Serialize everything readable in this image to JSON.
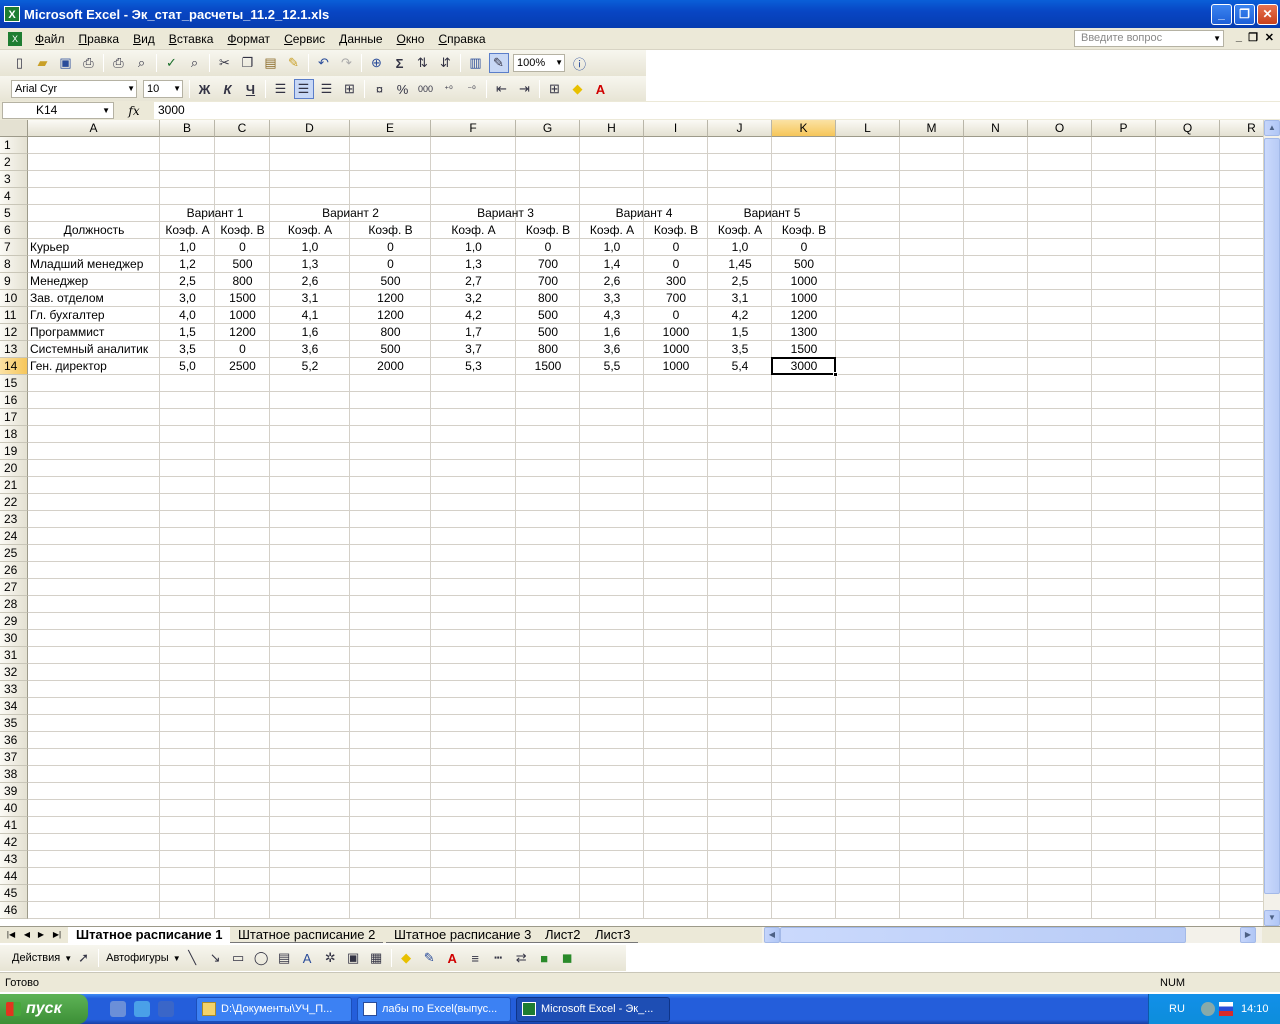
{
  "window": {
    "title": "Microsoft Excel - Эк_стат_расчеты_11.2_12.1.xls",
    "app_icon": "X",
    "min": "_",
    "restore": "❐",
    "close": "✕"
  },
  "menu": {
    "items": [
      "Файл",
      "Правка",
      "Вид",
      "Вставка",
      "Формат",
      "Сервис",
      "Данные",
      "Окно",
      "Справка"
    ],
    "help_placeholder": "Введите вопрос"
  },
  "toolbar": {
    "zoom": "100%",
    "font": "Arial Cyr",
    "size": "10",
    "bold": "Ж",
    "italic": "К",
    "underline": "Ч",
    "percent": "%",
    "thousands": "000",
    "sigma": "Σ"
  },
  "formula": {
    "namebox": "K14",
    "fx": "fx",
    "value": "3000"
  },
  "columns": [
    "A",
    "B",
    "C",
    "D",
    "E",
    "F",
    "G",
    "H",
    "I",
    "J",
    "K",
    "L",
    "M",
    "N",
    "O",
    "P",
    "Q",
    "R"
  ],
  "rows_count": 46,
  "selected": {
    "col": "K",
    "row": 14
  },
  "sheet": {
    "variants": [
      "Вариант 1",
      "Вариант 2",
      "Вариант 3",
      "Вариант 4",
      "Вариант 5"
    ],
    "position_header": "Должность",
    "coef_a": "Коэф. А",
    "coef_b": "Коэф. В",
    "rows": [
      {
        "name": "Курьер",
        "vals": [
          "1,0",
          "0",
          "1,0",
          "0",
          "1,0",
          "0",
          "1,0",
          "0",
          "1,0",
          "0"
        ]
      },
      {
        "name": "Младший менеджер",
        "vals": [
          "1,2",
          "500",
          "1,3",
          "0",
          "1,3",
          "700",
          "1,4",
          "0",
          "1,45",
          "500"
        ]
      },
      {
        "name": "Менеджер",
        "vals": [
          "2,5",
          "800",
          "2,6",
          "500",
          "2,7",
          "700",
          "2,6",
          "300",
          "2,5",
          "1000"
        ]
      },
      {
        "name": "Зав. отделом",
        "vals": [
          "3,0",
          "1500",
          "3,1",
          "1200",
          "3,2",
          "800",
          "3,3",
          "700",
          "3,1",
          "1000"
        ]
      },
      {
        "name": "Гл. бухгалтер",
        "vals": [
          "4,0",
          "1000",
          "4,1",
          "1200",
          "4,2",
          "500",
          "4,3",
          "0",
          "4,2",
          "1200"
        ]
      },
      {
        "name": "Программист",
        "vals": [
          "1,5",
          "1200",
          "1,6",
          "800",
          "1,7",
          "500",
          "1,6",
          "1000",
          "1,5",
          "1300"
        ]
      },
      {
        "name": "Системный аналитик",
        "vals": [
          "3,5",
          "0",
          "3,6",
          "500",
          "3,7",
          "800",
          "3,6",
          "1000",
          "3,5",
          "1500"
        ]
      },
      {
        "name": "Ген. директор",
        "vals": [
          "5,0",
          "2500",
          "5,2",
          "2000",
          "5,3",
          "1500",
          "5,5",
          "1000",
          "5,4",
          "3000"
        ]
      }
    ]
  },
  "tabs": [
    "Штатное расписание 1",
    "Штатное расписание 2",
    "Штатное расписание 3",
    "Лист2",
    "Лист3"
  ],
  "drawbar": {
    "actions": "Действия",
    "autoshapes": "Автофигуры"
  },
  "status": {
    "ready": "Готово",
    "num": "NUM"
  },
  "taskbar": {
    "start": "пуск",
    "items": [
      "D:\\Документы\\УЧ_П...",
      "лабы по Excel(выпус...",
      "Microsoft Excel - Эк_..."
    ],
    "lang": "RU",
    "time": "14:10"
  }
}
